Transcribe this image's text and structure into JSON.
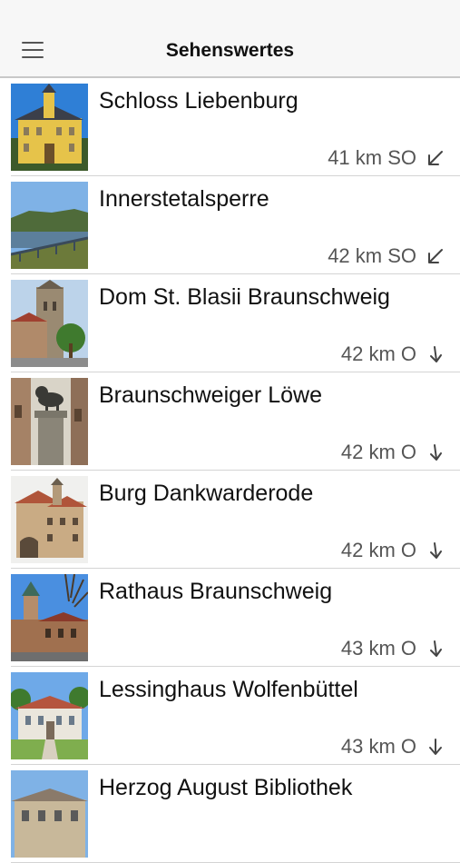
{
  "header": {
    "title": "Sehenswertes",
    "menu_icon": "hamburger-menu-icon"
  },
  "sights": [
    {
      "title": "Schloss Liebenburg",
      "distance": "41 km SO",
      "direction_icon": "arrow-down-left-icon"
    },
    {
      "title": "Innerstetalsperre",
      "distance": "42 km SO",
      "direction_icon": "arrow-down-left-icon"
    },
    {
      "title": "Dom St. Blasii Braunschweig",
      "distance": "42 km O",
      "direction_icon": "arrow-down-icon"
    },
    {
      "title": "Braunschweiger Löwe",
      "distance": "42 km O",
      "direction_icon": "arrow-down-icon"
    },
    {
      "title": "Burg Dankwarderode",
      "distance": "42 km O",
      "direction_icon": "arrow-down-icon"
    },
    {
      "title": "Rathaus Braunschweig",
      "distance": "43 km O",
      "direction_icon": "arrow-down-icon"
    },
    {
      "title": "Lessinghaus Wolfenbüttel",
      "distance": "43 km O",
      "direction_icon": "arrow-down-icon"
    },
    {
      "title": "Herzog August Bibliothek",
      "distance": "",
      "direction_icon": ""
    }
  ]
}
